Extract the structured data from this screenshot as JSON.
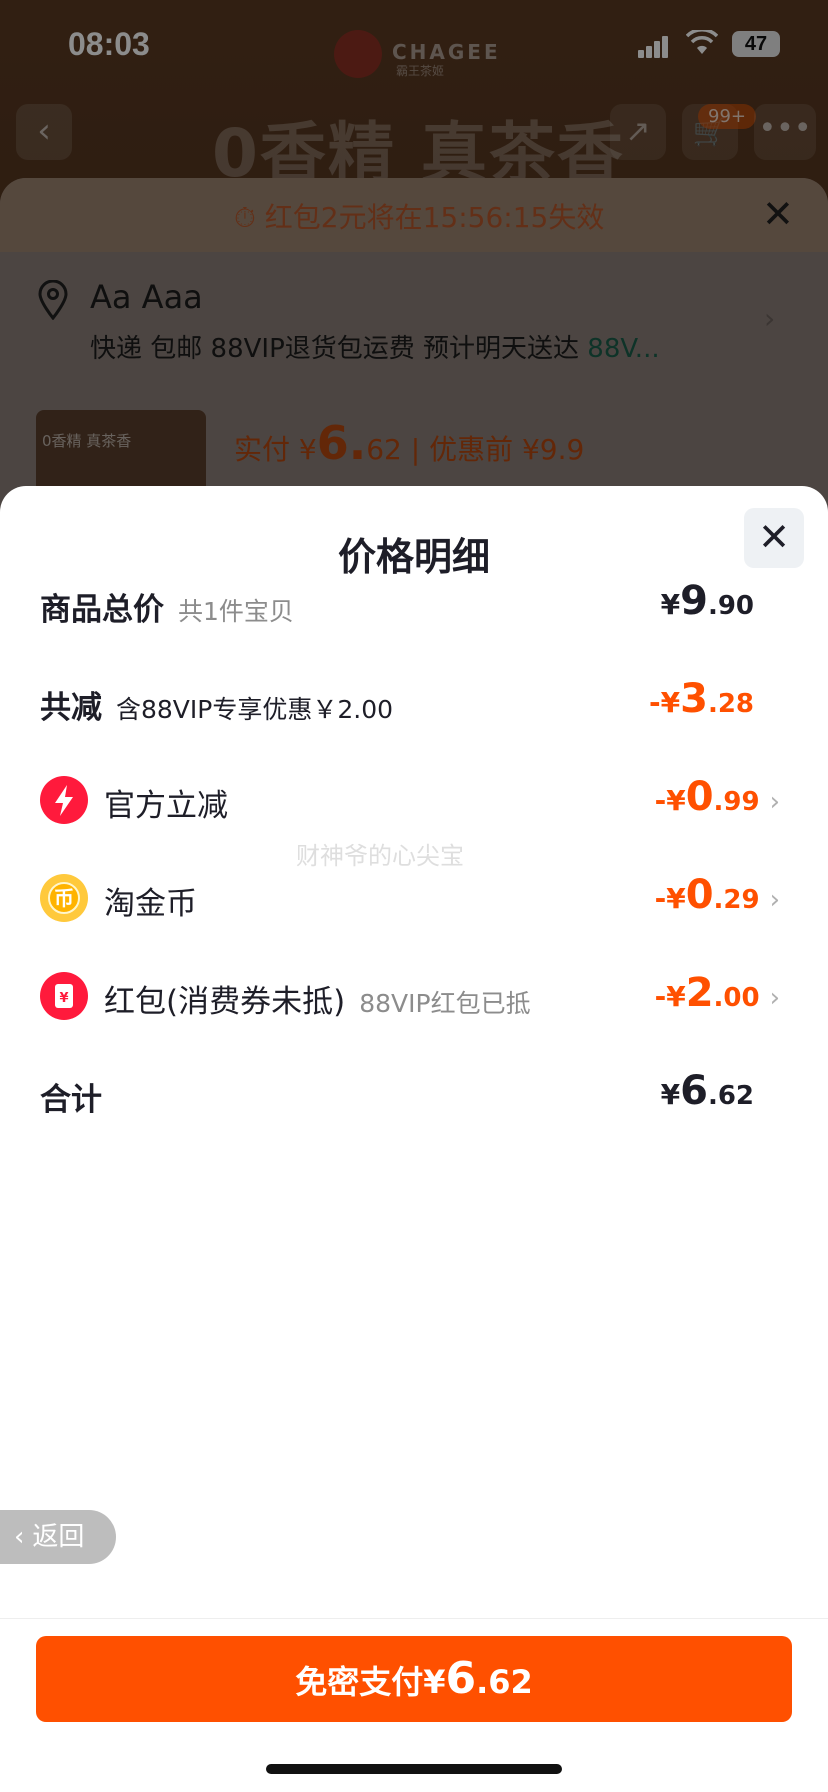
{
  "status_bar": {
    "time": "08:03",
    "battery": "47"
  },
  "background": {
    "brand": "CHAGEE",
    "brand_sub": "霸王茶姬",
    "hero_title": "0香精 真茶香",
    "cart_badge": "99+",
    "coupon_text": "红包2元将在15:56:15失效",
    "address_name": "Aa Aaa",
    "shipping_text": "快递 包邮 88VIP退货包运费 预计明天送达",
    "shipping_vip": "88V...",
    "thumb_text": "0香精 真茶香",
    "pay_prefix": "实付 ¥",
    "pay_int": "6.",
    "pay_dec": "62",
    "pay_before": "| 优惠前 ¥9.9"
  },
  "modal": {
    "title": "价格明细",
    "rows": [
      {
        "label": "商品总价",
        "sub": "共1件宝贝",
        "sign": "¥",
        "int": "9",
        "dec": ".90"
      },
      {
        "label": "共减",
        "sub": "含88VIP专享优惠￥2.00",
        "sign": "-¥",
        "int": "3",
        "dec": ".28"
      },
      {
        "label": "官方立减",
        "sub": "",
        "sign": "-¥",
        "int": "0",
        "dec": ".99"
      },
      {
        "label": "淘金币",
        "sub": "",
        "sign": "-¥",
        "int": "0",
        "dec": ".29"
      },
      {
        "label": "红包(消费券未抵)",
        "sub": "88VIP红包已抵",
        "sign": "-¥",
        "int": "2",
        "dec": ".00"
      },
      {
        "label": "合计",
        "sub": "",
        "sign": "¥",
        "int": "6",
        "dec": ".62"
      }
    ],
    "watermark": "财神爷的心尖宝"
  },
  "back_button": "返回",
  "pay_button": {
    "label": "免密支付",
    "sign": "¥",
    "int": "6",
    "dec": ".62"
  },
  "colors": {
    "accent": "#ff5000",
    "text": "#1e1e28",
    "muted": "#8c8c8c"
  }
}
